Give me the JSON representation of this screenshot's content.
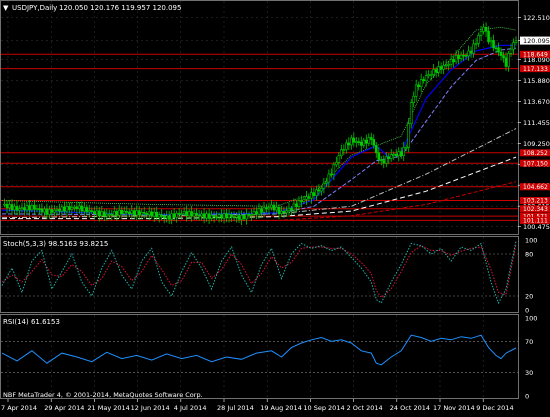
{
  "main_panel": {
    "title": "USDJPY,Daily",
    "ohlc": "120.050 120.176 119.957 120.095",
    "price_ticks": [
      "122.510",
      "120.095",
      "118.090",
      "115.880",
      "113.670",
      "111.455",
      "109.250",
      "107.040",
      "104.830",
      "102.615",
      "100.475"
    ],
    "hline_labels": [
      "118.649",
      "117.133",
      "108.252",
      "107.150",
      "104.662",
      "103.213",
      "102.343",
      "101.571",
      "101.111"
    ]
  },
  "stoch_panel": {
    "title": "Stoch(5,3,3) 98.5163 93.8215",
    "ticks": [
      "100",
      "80",
      "20",
      "0"
    ]
  },
  "rsi_panel": {
    "title": "RSI(14) 61.6153",
    "ticks": [
      "100",
      "70",
      "30",
      "0"
    ]
  },
  "footer": {
    "credit": "NBF MetaTrader 4, © 2001-2014, MetaQuotes Software Corp."
  },
  "x_axis": {
    "labels": [
      "7 Apr 2014",
      "29 Apr 2014",
      "21 May 2014",
      "12 Jun 2014",
      "4 Jul 2014",
      "28 Jul 2014",
      "19 Aug 2014",
      "10 Sep 2014",
      "2 Oct 2014",
      "24 Oct 2014",
      "17 Nov 2014",
      "9 Dec 2014"
    ]
  },
  "chart_data": {
    "type": "candlestick",
    "symbol": "USDJPY",
    "timeframe": "Daily",
    "x_range": [
      "2014-04-07",
      "2014-12-17"
    ],
    "y_range": [
      100.475,
      122.51
    ],
    "close_path": [
      [
        0,
        102.8
      ],
      [
        6,
        102.3
      ],
      [
        12,
        102.5
      ],
      [
        18,
        102.0
      ],
      [
        24,
        102.3
      ],
      [
        30,
        102.5
      ],
      [
        36,
        102.0
      ],
      [
        42,
        101.7
      ],
      [
        48,
        102.0
      ],
      [
        54,
        101.9
      ],
      [
        60,
        101.8
      ],
      [
        66,
        101.4
      ],
      [
        72,
        101.9
      ],
      [
        78,
        101.7
      ],
      [
        84,
        101.5
      ],
      [
        90,
        101.6
      ],
      [
        96,
        101.4
      ],
      [
        102,
        102.0
      ],
      [
        108,
        102.6
      ],
      [
        112,
        101.9
      ],
      [
        116,
        102.4
      ],
      [
        120,
        103.2
      ],
      [
        124,
        103.8
      ],
      [
        128,
        104.5
      ],
      [
        132,
        106.2
      ],
      [
        136,
        108.5
      ],
      [
        140,
        109.6
      ],
      [
        144,
        109.2
      ],
      [
        148,
        109.8
      ],
      [
        150,
        108.2
      ],
      [
        152,
        107.2
      ],
      [
        156,
        108.0
      ],
      [
        160,
        108.2
      ],
      [
        162,
        109.0
      ],
      [
        164,
        113.5
      ],
      [
        166,
        115.2
      ],
      [
        170,
        116.3
      ],
      [
        174,
        117.0
      ],
      [
        178,
        117.5
      ],
      [
        182,
        118.3
      ],
      [
        186,
        118.6
      ],
      [
        188,
        119.0
      ],
      [
        190,
        120.0
      ],
      [
        193,
        121.6
      ],
      [
        195,
        120.2
      ],
      [
        198,
        119.2
      ],
      [
        200,
        118.6
      ],
      [
        202,
        117.6
      ],
      [
        204,
        119.4
      ],
      [
        206,
        120.1
      ]
    ],
    "ma_fast": [
      [
        0,
        102.2
      ],
      [
        60,
        101.7
      ],
      [
        110,
        101.9
      ],
      [
        125,
        103.3
      ],
      [
        140,
        107.8
      ],
      [
        150,
        109.0
      ],
      [
        155,
        107.8
      ],
      [
        160,
        108.3
      ],
      [
        170,
        114.0
      ],
      [
        180,
        117.0
      ],
      [
        190,
        119.0
      ],
      [
        200,
        119.6
      ],
      [
        206,
        119.6
      ]
    ],
    "ma_slow": [
      [
        0,
        101.8
      ],
      [
        60,
        101.7
      ],
      [
        110,
        101.8
      ],
      [
        125,
        102.6
      ],
      [
        140,
        105.4
      ],
      [
        150,
        107.4
      ],
      [
        160,
        107.9
      ],
      [
        170,
        111.6
      ],
      [
        180,
        115.2
      ],
      [
        190,
        118.0
      ],
      [
        200,
        119.1
      ],
      [
        206,
        119.3
      ]
    ],
    "ma_100": [
      [
        0,
        101.4
      ],
      [
        60,
        101.6
      ],
      [
        110,
        101.8
      ],
      [
        140,
        102.6
      ],
      [
        170,
        106.0
      ],
      [
        206,
        110.8
      ]
    ],
    "ma_200": [
      [
        0,
        101.3
      ],
      [
        60,
        101.3
      ],
      [
        110,
        101.5
      ],
      [
        140,
        102.1
      ],
      [
        170,
        104.2
      ],
      [
        206,
        107.8
      ]
    ],
    "ma_365": [
      [
        0,
        101.1
      ],
      [
        110,
        101.1
      ],
      [
        140,
        101.6
      ],
      [
        170,
        102.8
      ],
      [
        206,
        105.2
      ]
    ],
    "ma_envelope": [
      [
        0,
        103.2
      ],
      [
        60,
        102.8
      ],
      [
        110,
        102.6
      ],
      [
        125,
        104.0
      ],
      [
        140,
        108.0
      ],
      [
        160,
        110.0
      ],
      [
        170,
        115.5
      ],
      [
        180,
        118.2
      ],
      [
        190,
        121.2
      ],
      [
        200,
        121.5
      ],
      [
        206,
        121.2
      ]
    ],
    "horizontal_levels": [
      118.649,
      117.133,
      108.252,
      107.15,
      104.662,
      103.213,
      102.343,
      101.571,
      101.111
    ],
    "stochastic": {
      "k": 98.5163,
      "d": 93.8215,
      "levels": [
        80,
        20
      ],
      "k_path": [
        [
          0,
          35
        ],
        [
          4,
          60
        ],
        [
          8,
          25
        ],
        [
          12,
          70
        ],
        [
          16,
          85
        ],
        [
          20,
          30
        ],
        [
          24,
          55
        ],
        [
          28,
          80
        ],
        [
          32,
          40
        ],
        [
          36,
          20
        ],
        [
          40,
          60
        ],
        [
          44,
          85
        ],
        [
          48,
          50
        ],
        [
          52,
          30
        ],
        [
          56,
          70
        ],
        [
          60,
          88
        ],
        [
          64,
          40
        ],
        [
          68,
          20
        ],
        [
          72,
          55
        ],
        [
          76,
          82
        ],
        [
          80,
          60
        ],
        [
          84,
          30
        ],
        [
          88,
          70
        ],
        [
          92,
          90
        ],
        [
          96,
          50
        ],
        [
          100,
          25
        ],
        [
          104,
          65
        ],
        [
          108,
          88
        ],
        [
          112,
          45
        ],
        [
          116,
          80
        ],
        [
          120,
          95
        ],
        [
          124,
          88
        ],
        [
          128,
          92
        ],
        [
          132,
          85
        ],
        [
          136,
          90
        ],
        [
          140,
          75
        ],
        [
          144,
          60
        ],
        [
          148,
          40
        ],
        [
          150,
          15
        ],
        [
          152,
          10
        ],
        [
          156,
          40
        ],
        [
          160,
          65
        ],
        [
          164,
          95
        ],
        [
          168,
          92
        ],
        [
          172,
          80
        ],
        [
          176,
          88
        ],
        [
          180,
          70
        ],
        [
          184,
          90
        ],
        [
          188,
          85
        ],
        [
          192,
          95
        ],
        [
          196,
          40
        ],
        [
          199,
          10
        ],
        [
          202,
          30
        ],
        [
          206,
          98.5
        ]
      ],
      "d_path": [
        [
          0,
          40
        ],
        [
          4,
          50
        ],
        [
          8,
          40
        ],
        [
          12,
          55
        ],
        [
          16,
          72
        ],
        [
          20,
          50
        ],
        [
          24,
          48
        ],
        [
          28,
          65
        ],
        [
          32,
          55
        ],
        [
          36,
          35
        ],
        [
          40,
          45
        ],
        [
          44,
          70
        ],
        [
          48,
          62
        ],
        [
          52,
          42
        ],
        [
          56,
          55
        ],
        [
          60,
          78
        ],
        [
          64,
          58
        ],
        [
          68,
          35
        ],
        [
          72,
          42
        ],
        [
          76,
          68
        ],
        [
          80,
          68
        ],
        [
          84,
          45
        ],
        [
          88,
          58
        ],
        [
          92,
          80
        ],
        [
          96,
          65
        ],
        [
          100,
          38
        ],
        [
          104,
          52
        ],
        [
          108,
          76
        ],
        [
          112,
          60
        ],
        [
          116,
          68
        ],
        [
          120,
          88
        ],
        [
          124,
          90
        ],
        [
          128,
          90
        ],
        [
          132,
          88
        ],
        [
          136,
          88
        ],
        [
          140,
          80
        ],
        [
          144,
          68
        ],
        [
          148,
          52
        ],
        [
          150,
          28
        ],
        [
          152,
          18
        ],
        [
          156,
          30
        ],
        [
          160,
          55
        ],
        [
          164,
          82
        ],
        [
          168,
          92
        ],
        [
          172,
          85
        ],
        [
          176,
          85
        ],
        [
          180,
          78
        ],
        [
          184,
          84
        ],
        [
          188,
          88
        ],
        [
          192,
          90
        ],
        [
          196,
          58
        ],
        [
          199,
          25
        ],
        [
          202,
          22
        ],
        [
          206,
          93.8
        ]
      ]
    },
    "rsi": {
      "value": 61.6153,
      "levels": [
        70,
        30
      ],
      "path": [
        [
          0,
          55
        ],
        [
          6,
          45
        ],
        [
          12,
          58
        ],
        [
          18,
          42
        ],
        [
          24,
          55
        ],
        [
          30,
          50
        ],
        [
          36,
          44
        ],
        [
          42,
          56
        ],
        [
          48,
          48
        ],
        [
          54,
          52
        ],
        [
          60,
          46
        ],
        [
          66,
          54
        ],
        [
          72,
          48
        ],
        [
          78,
          52
        ],
        [
          84,
          44
        ],
        [
          90,
          50
        ],
        [
          96,
          47
        ],
        [
          102,
          55
        ],
        [
          108,
          58
        ],
        [
          112,
          50
        ],
        [
          116,
          62
        ],
        [
          120,
          68
        ],
        [
          124,
          72
        ],
        [
          128,
          75
        ],
        [
          132,
          70
        ],
        [
          136,
          72
        ],
        [
          140,
          68
        ],
        [
          144,
          58
        ],
        [
          148,
          55
        ],
        [
          150,
          42
        ],
        [
          152,
          40
        ],
        [
          156,
          50
        ],
        [
          160,
          58
        ],
        [
          164,
          78
        ],
        [
          168,
          75
        ],
        [
          172,
          70
        ],
        [
          176,
          74
        ],
        [
          180,
          72
        ],
        [
          184,
          76
        ],
        [
          188,
          74
        ],
        [
          192,
          78
        ],
        [
          195,
          62
        ],
        [
          198,
          52
        ],
        [
          200,
          48
        ],
        [
          202,
          55
        ],
        [
          206,
          61.6
        ]
      ]
    }
  },
  "colors": {
    "background": "#000000",
    "grid": "#3a3a3a",
    "axis_text": "#ffffff",
    "candle_body": "#00cc00",
    "level_line": "#cc0000",
    "level_label_bg": "#cc0000",
    "ma_fast": "#0000ff",
    "ma_slow": "#8080ff",
    "ma_white": "#ffffff",
    "ma_365": "#c80000",
    "ma_envelope": "#4dd04d",
    "stoch_k": "#20b2aa",
    "stoch_d": "#dc143c",
    "rsi_line": "#1e90ff",
    "current_price_bg": "#ffffff"
  }
}
